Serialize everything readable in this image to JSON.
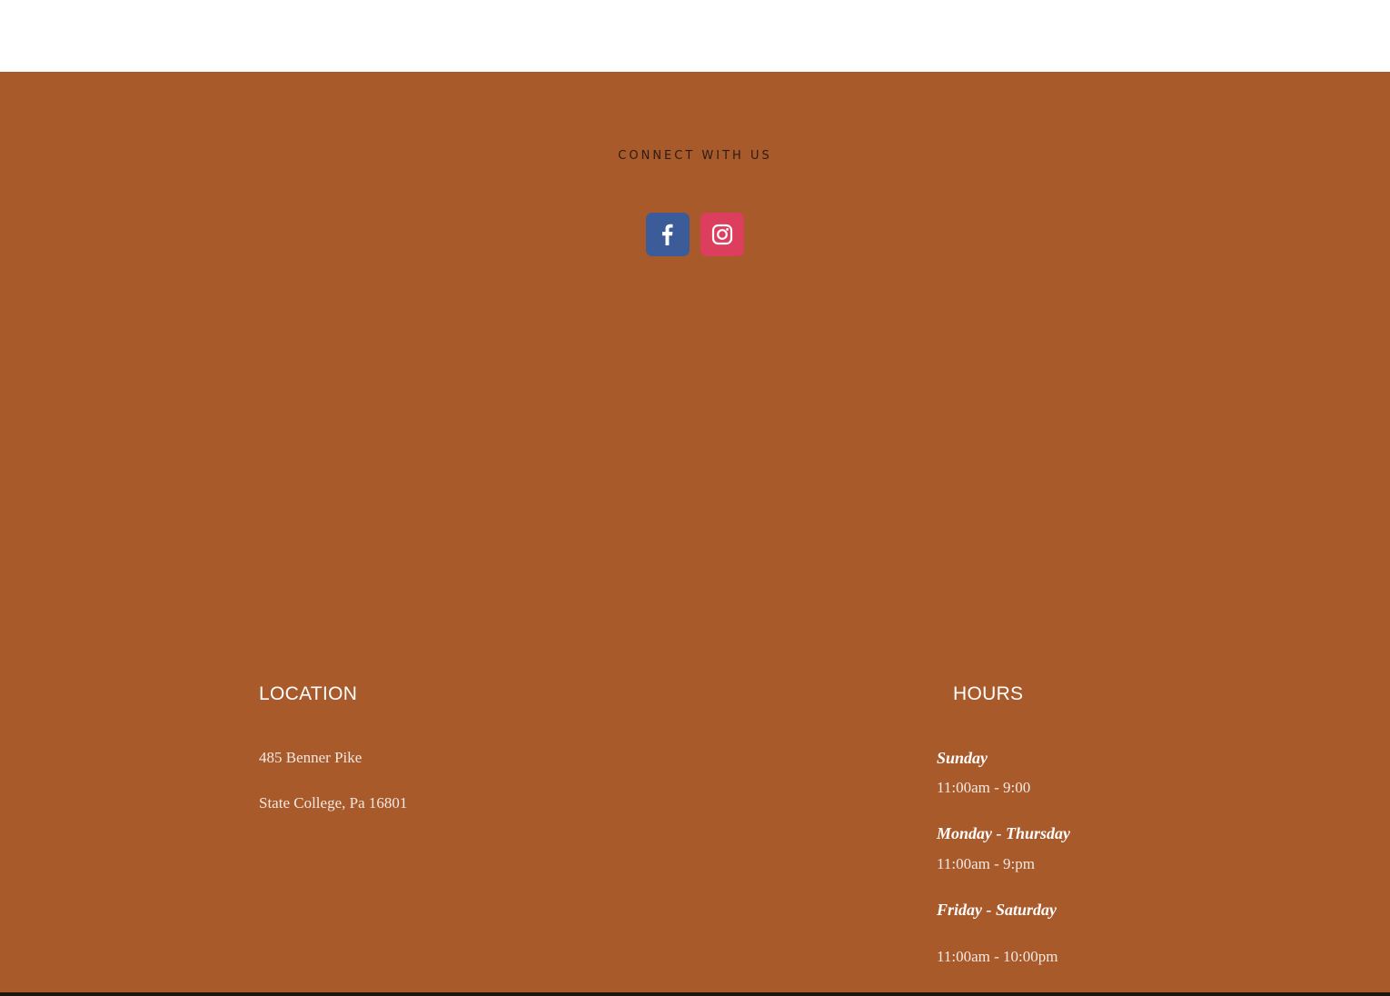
{
  "colors": {
    "footer_bg": "#a95a2b",
    "facebook": "#3b5b99",
    "instagram": "#de3e5d",
    "heading_text": "#ffffff",
    "body_text": "#f3e9e2",
    "connect_text": "#2a1c14"
  },
  "connect": {
    "heading": "CONNECT WITH US",
    "social": [
      {
        "name": "Facebook",
        "icon": "facebook-icon"
      },
      {
        "name": "Instagram",
        "icon": "instagram-icon"
      }
    ]
  },
  "location": {
    "heading": "LOCATION",
    "address_line1": "485 Benner Pike",
    "address_line2": "State College, Pa 16801"
  },
  "hours": {
    "heading": "HOURS",
    "entries": [
      {
        "day": "Sunday",
        "time": "11:00am - 9:00"
      },
      {
        "day": "Monday - Thursday",
        "time": "11:00am - 9:pm"
      },
      {
        "day": "Friday - Saturday",
        "time": "11:00am - 10:00pm"
      }
    ]
  }
}
